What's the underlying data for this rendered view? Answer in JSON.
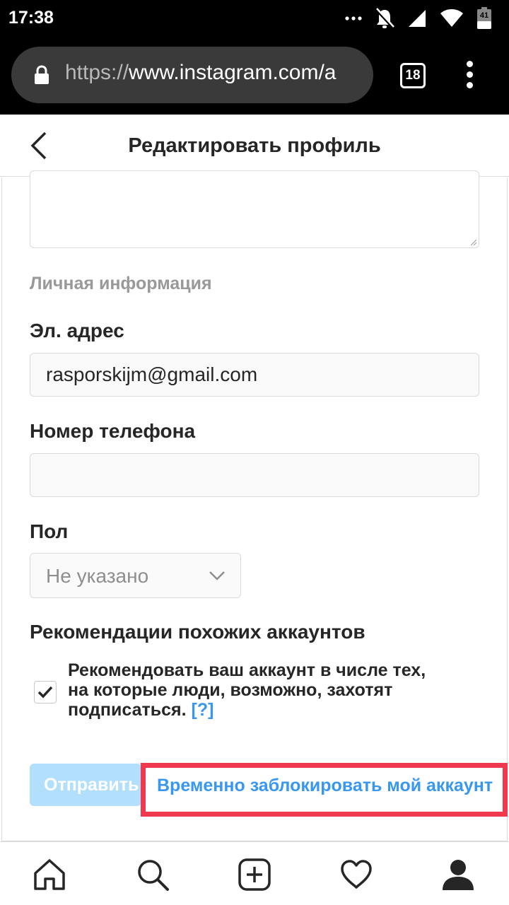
{
  "status_bar": {
    "time": "17:38",
    "battery_level": "41",
    "icons": [
      "more-dots-icon",
      "notifications-off-icon",
      "cell-signal-icon",
      "wifi-icon",
      "battery-icon"
    ]
  },
  "browser": {
    "url_scheme": "https://",
    "url_host": "www.instagram.com/a",
    "tab_count": "18",
    "icons": [
      "lock-icon",
      "tabs-icon",
      "overflow-menu-icon"
    ]
  },
  "header": {
    "title": "Редактировать профиль",
    "back_icon": "chevron-left-icon"
  },
  "form": {
    "section_personal": "Личная информация",
    "email_label": "Эл. адрес",
    "email_value": "rasporskijm@gmail.com",
    "phone_label": "Номер телефона",
    "phone_value": "",
    "gender_label": "Пол",
    "gender_value": "Не указано",
    "recommend_heading": "Рекомендации похожих аккаунтов",
    "recommend_text": "Рекомендовать ваш аккаунт в числе тех, на которые люди, возможно, захотят подписаться.",
    "recommend_help": "[?]",
    "recommend_checked": true,
    "submit_label": "Отправить",
    "block_account_link": "Временно заблокировать мой аккаунт"
  },
  "colors": {
    "accent": "#3897f0",
    "highlight": "#f0384f",
    "submit_disabled": "#b2dffc"
  },
  "bottom_nav": {
    "items": [
      "home-icon",
      "search-icon",
      "new-post-icon",
      "activity-heart-icon",
      "profile-icon"
    ]
  }
}
